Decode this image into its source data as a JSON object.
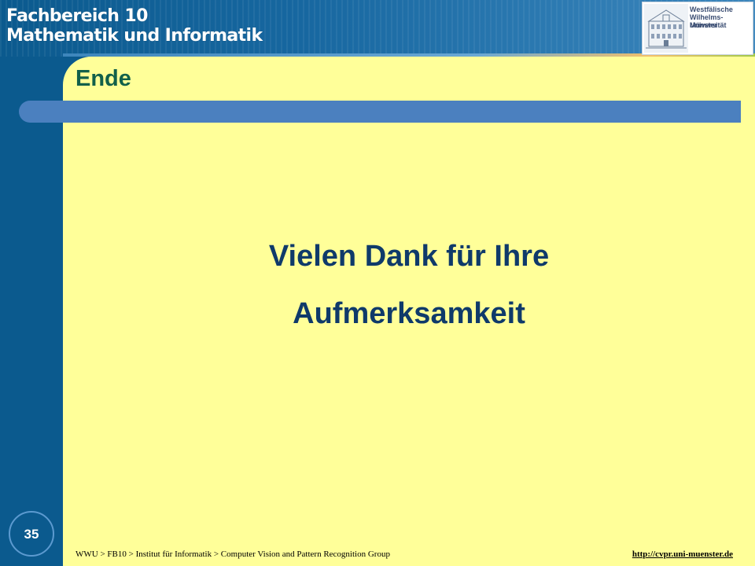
{
  "header": {
    "department_line1": "Fachbereich 10",
    "department_line2": "Mathematik und Informatik",
    "university_lines": [
      "Westfälische",
      "Wilhelms-Universität",
      "Münster"
    ]
  },
  "slide": {
    "title": "Ende",
    "message_line1": "Vielen Dank für Ihre",
    "message_line2": "Aufmerksamkeit",
    "page_number": "35"
  },
  "footer": {
    "breadcrumb": "WWU > FB10 > Institut für Informatik > Computer Vision  and Pattern Recognition Group",
    "url": "http://cvpr.uni-muenster.de"
  },
  "colors": {
    "background": "#ffff99",
    "sidebar": "#0b5a8e",
    "title_text": "#12604a",
    "title_bar": "#4b80bf",
    "message_text": "#0f3a6a"
  },
  "icons": {
    "university_logo": "university-building-icon"
  }
}
